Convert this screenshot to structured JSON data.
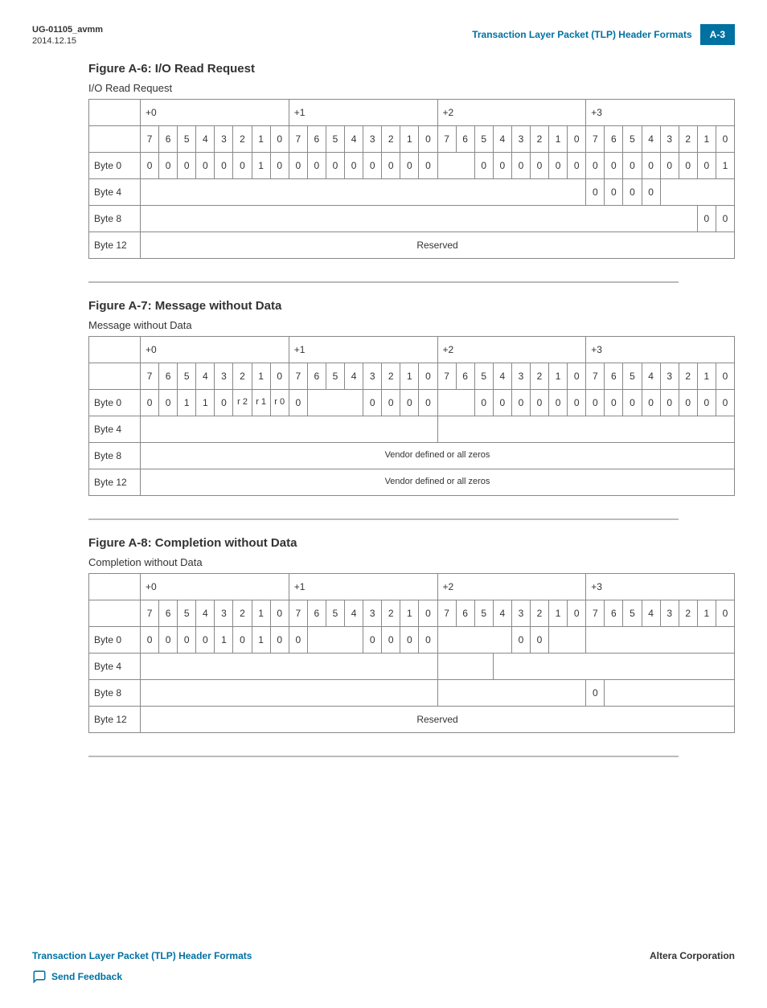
{
  "header": {
    "doc_id": "UG-01105_avmm",
    "date": "2014.12.15",
    "section_title": "Transaction Layer Packet (TLP) Header Formats",
    "page_number": "A-3"
  },
  "figA6": {
    "title": "Figure A-6: I/O Read Request",
    "subtitle": "I/O Read Request",
    "offsets": [
      "+0",
      "+1",
      "+2",
      "+3"
    ],
    "bits": [
      "7",
      "6",
      "5",
      "4",
      "3",
      "2",
      "1",
      "0",
      "7",
      "6",
      "5",
      "4",
      "3",
      "2",
      "1",
      "0",
      "7",
      "6",
      "5",
      "4",
      "3",
      "2",
      "1",
      "0",
      "7",
      "6",
      "5",
      "4",
      "3",
      "2",
      "1",
      "0"
    ],
    "rows": [
      {
        "label": "Byte 0",
        "cells": [
          "0",
          "0",
          "0",
          "0",
          "0",
          "0",
          "1",
          "0",
          "0",
          "0",
          "0",
          "0",
          "0",
          "0",
          "0",
          "0",
          {
            "text": "",
            "span": 2
          },
          "0",
          "0",
          "0",
          "0",
          "0",
          "0",
          "0",
          "0",
          "0",
          "0",
          "0",
          "0",
          "0",
          "1"
        ]
      },
      {
        "label": "Byte 4",
        "cells": [
          {
            "text": "",
            "span": 24
          },
          "0",
          "0",
          "0",
          "0",
          {
            "text": "",
            "span": 4
          }
        ]
      },
      {
        "label": "Byte 8",
        "cells": [
          {
            "text": "",
            "span": 30
          },
          "0",
          "0"
        ]
      },
      {
        "label": "Byte 12",
        "cells": [
          {
            "text": "Reserved",
            "span": 32
          }
        ]
      }
    ]
  },
  "figA7": {
    "title": "Figure A-7: Message without Data",
    "subtitle": "Message without Data",
    "offsets": [
      "+0",
      "+1",
      "+2",
      "+3"
    ],
    "bits": [
      "7",
      "6",
      "5",
      "4",
      "3",
      "2",
      "1",
      "0",
      "7",
      "6",
      "5",
      "4",
      "3",
      "2",
      "1",
      "0",
      "7",
      "6",
      "5",
      "4",
      "3",
      "2",
      "1",
      "0",
      "7",
      "6",
      "5",
      "4",
      "3",
      "2",
      "1",
      "0"
    ],
    "rows": [
      {
        "label": "Byte 0",
        "cells": [
          "0",
          "0",
          "1",
          "1",
          "0",
          "r 2",
          "r 1",
          "r 0",
          "0",
          {
            "text": "",
            "span": 3
          },
          "0",
          "0",
          "0",
          "0",
          {
            "text": "",
            "span": 2
          },
          "0",
          "0",
          "0",
          "0",
          "0",
          "0",
          "0",
          "0",
          "0",
          "0",
          "0",
          "0",
          "0",
          "0"
        ]
      },
      {
        "label": "Byte 4",
        "cells": [
          {
            "text": "",
            "span": 16
          },
          {
            "text": "",
            "span": 16
          }
        ]
      },
      {
        "label": "Byte 8",
        "cells": [
          {
            "text": "Vendor defined or all zeros",
            "span": 32
          }
        ]
      },
      {
        "label": "Byte 12",
        "cells": [
          {
            "text": "Vendor defined or all zeros",
            "span": 32
          }
        ]
      }
    ]
  },
  "figA8": {
    "title": "Figure A-8: Completion without Data",
    "subtitle": "Completion without Data",
    "offsets": [
      "+0",
      "+1",
      "+2",
      "+3"
    ],
    "bits": [
      "7",
      "6",
      "5",
      "4",
      "3",
      "2",
      "1",
      "0",
      "7",
      "6",
      "5",
      "4",
      "3",
      "2",
      "1",
      "0",
      "7",
      "6",
      "5",
      "4",
      "3",
      "2",
      "1",
      "0",
      "7",
      "6",
      "5",
      "4",
      "3",
      "2",
      "1",
      "0"
    ],
    "rows": [
      {
        "label": "Byte 0",
        "cells": [
          "0",
          "0",
          "0",
          "0",
          "1",
          "0",
          "1",
          "0",
          "0",
          {
            "text": "",
            "span": 3
          },
          "0",
          "0",
          "0",
          "0",
          {
            "text": "",
            "span": 4
          },
          "0",
          "0",
          {
            "text": "",
            "span": 2
          },
          {
            "text": "",
            "span": 8
          }
        ]
      },
      {
        "label": "Byte 4",
        "cells": [
          {
            "text": "",
            "span": 16
          },
          {
            "text": "",
            "span": 3
          },
          {
            "text": "",
            "span": 13
          }
        ]
      },
      {
        "label": "Byte 8",
        "cells": [
          {
            "text": "",
            "span": 16
          },
          {
            "text": "",
            "span": 8
          },
          "0",
          {
            "text": "",
            "span": 7
          }
        ]
      },
      {
        "label": "Byte 12",
        "cells": [
          {
            "text": "Reserved",
            "span": 32
          }
        ]
      }
    ]
  },
  "footer": {
    "left": "Transaction Layer Packet (TLP) Header Formats",
    "right": "Altera Corporation",
    "feedback": "Send Feedback"
  }
}
